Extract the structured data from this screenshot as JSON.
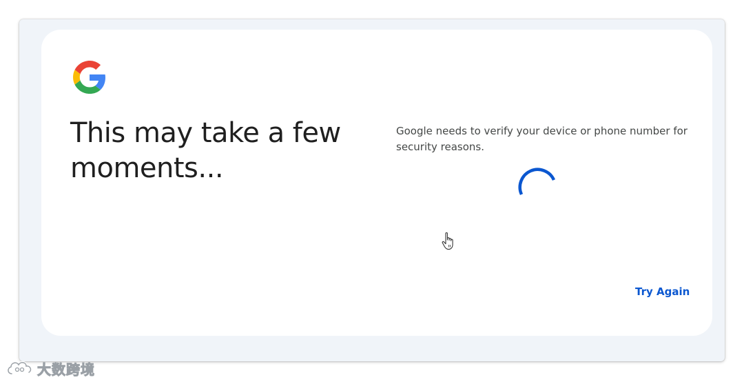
{
  "dialog": {
    "headline": "This may take a few moments...",
    "message": "Google needs to verify your device or phone number for security reasons.",
    "try_again_label": "Try Again"
  },
  "icons": {
    "logo": "google-g-logo",
    "spinner": "loading-spinner",
    "cursor": "hand-pointer-cursor",
    "watermark": "cloud-logo"
  },
  "watermark": {
    "text": "大数跨境"
  },
  "colors": {
    "primary": "#0b57d0",
    "spinner": "#0b57d0",
    "headline": "#1f1f1f",
    "body_text": "#444746",
    "frame_background": "#f0f4f9",
    "card_background": "#ffffff"
  }
}
